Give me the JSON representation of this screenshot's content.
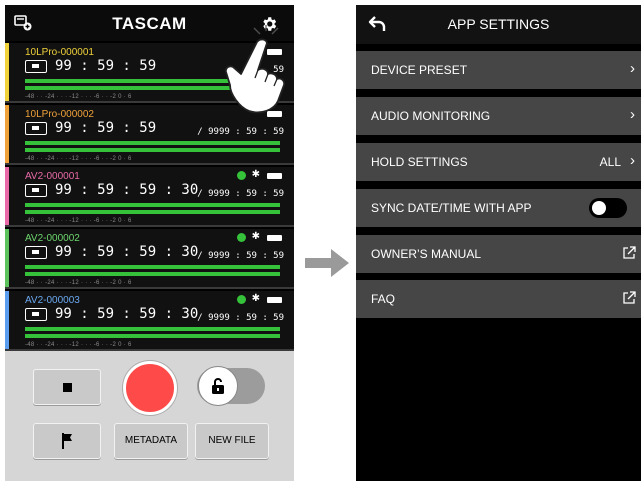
{
  "left": {
    "brand": "TASCAM",
    "devices": [
      {
        "name": "10LPro-000001",
        "name_color": "#f0d23a",
        "stripe": "#f0d23a",
        "timecode": "99 : 59 : 59",
        "remaining": "59",
        "level": 0.83,
        "show_bt": false,
        "scale": "-48  ·  ·  -24  ·  ·  ·  -12  ·  ·  ·  -6  ·  ·  -2  0  ·  6"
      },
      {
        "name": "10LPro-000002",
        "name_color": "#f0a23a",
        "stripe": "#f0a23a",
        "timecode": "99 : 59 : 59",
        "remaining": "/ 9999 : 59 : 59",
        "level": 0.98,
        "show_bt": false,
        "scale": "-48  ·  ·  -24  ·  ·  ·  -12  ·  ·  ·  -6  ·  ·  -2  0  ·  6"
      },
      {
        "name": "AV2-000001",
        "name_color": "#e86aa8",
        "stripe": "#e86aa8",
        "timecode": "99 : 59 : 59 : 30",
        "remaining": "/ 9999 : 59 : 59",
        "level": 0.98,
        "show_bt": true,
        "scale": "-48  ·  ·  -24  ·  ·  ·  -12  ·  ·  ·  -6  ·  ·  -2  0  ·  6"
      },
      {
        "name": "AV2-000002",
        "name_color": "#6dd66d",
        "stripe": "#5cc25c",
        "timecode": "99 : 59 : 59 : 30",
        "remaining": "/ 9999 : 59 : 59",
        "level": 0.98,
        "show_bt": true,
        "scale": "-48  ·  ·  -24  ·  ·  ·  -12  ·  ·  ·  -6  ·  ·  -2  0  ·  6"
      },
      {
        "name": "AV2-000003",
        "name_color": "#6aa8f0",
        "stripe": "#5a9cf0",
        "timecode": "99 : 59 : 59 : 30",
        "remaining": "/ 9999 : 59 : 59",
        "level": 0.98,
        "show_bt": true,
        "scale": "-48  ·  ·  -24  ·  ·  ·  -12  ·  ·  ·  -6  ·  ·  -2  0  ·  6"
      }
    ],
    "buttons": {
      "metadata": "METADATA",
      "new_file": "NEW FILE"
    },
    "icons": [
      "devices-icon",
      "gear-icon",
      "stop-icon",
      "record-icon",
      "lock-icon",
      "flag-icon",
      "pointing-hand-icon"
    ]
  },
  "right": {
    "title": "APP SETTINGS",
    "rows": [
      {
        "label": "DEVICE PRESET",
        "value": "",
        "kind": "chevron"
      },
      {
        "label": "AUDIO MONITORING",
        "value": "",
        "kind": "chevron"
      },
      {
        "label": "HOLD SETTINGS",
        "value": "ALL",
        "kind": "chevron"
      },
      {
        "label": "SYNC DATE/TIME WITH APP",
        "value": "",
        "kind": "toggle",
        "on": false
      },
      {
        "label": "OWNER’S MANUAL",
        "value": "",
        "kind": "external"
      },
      {
        "label": "FAQ",
        "value": "",
        "kind": "external"
      }
    ]
  }
}
